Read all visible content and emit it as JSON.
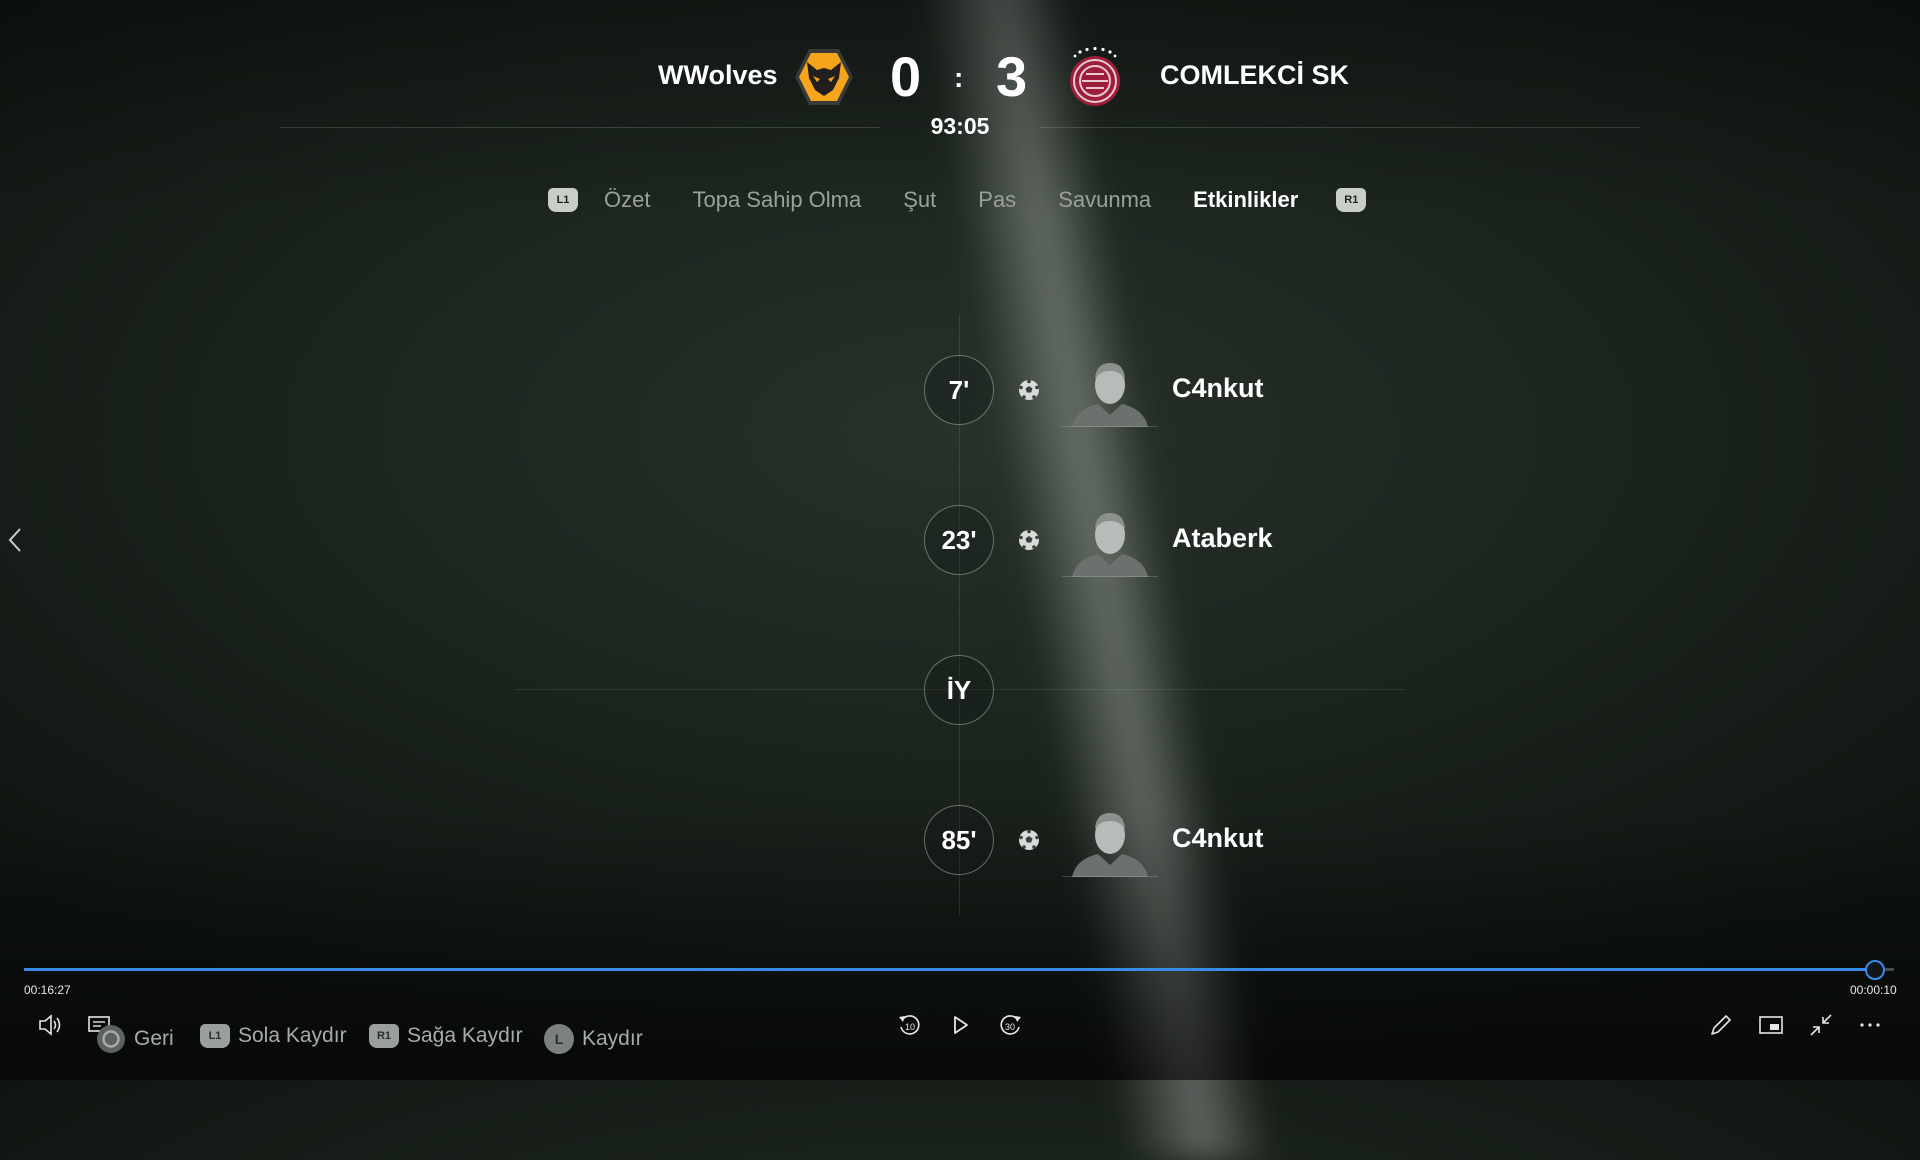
{
  "scoreboard": {
    "home": {
      "name": "WWolves",
      "score": "0",
      "crest_icon": "wolves-crest-icon",
      "crest_color": "#f4a51c"
    },
    "away": {
      "name": "COMLEKCİ SK",
      "score": "3",
      "crest_icon": "club-crest-icon",
      "crest_color": "#9c1e3a"
    },
    "separator": ":",
    "clock": "93:05"
  },
  "tabs": {
    "prev_button": "L1",
    "next_button": "R1",
    "items": [
      {
        "label": "Özet",
        "active": false
      },
      {
        "label": "Topa Sahip Olma",
        "active": false
      },
      {
        "label": "Şut",
        "active": false
      },
      {
        "label": "Pas",
        "active": false
      },
      {
        "label": "Savunma",
        "active": false
      },
      {
        "label": "Etkinlikler",
        "active": true
      }
    ]
  },
  "timeline": {
    "events": [
      {
        "minute": "7'",
        "type": "goal",
        "icon": "soccer-ball-icon",
        "player": "C4nkut"
      },
      {
        "minute": "23'",
        "type": "goal",
        "icon": "soccer-ball-icon",
        "player": "Ataberk"
      },
      {
        "minute": "85'",
        "type": "goal",
        "icon": "soccer-ball-icon",
        "player": "C4nkut"
      }
    ],
    "half_time_label": "İY"
  },
  "player_bar": {
    "elapsed": "00:16:27",
    "remaining": "00:00:10",
    "progress_fraction": 0.99,
    "accent_color": "#3a8be8",
    "hints": [
      {
        "button": "○",
        "label": "Geri"
      },
      {
        "button": "L1",
        "label": "Sola Kaydır"
      },
      {
        "button": "R1",
        "label": "Sağa Kaydır"
      },
      {
        "button": "L",
        "label": "Kaydır"
      }
    ],
    "rewind_label": "10",
    "forward_label": "30"
  }
}
